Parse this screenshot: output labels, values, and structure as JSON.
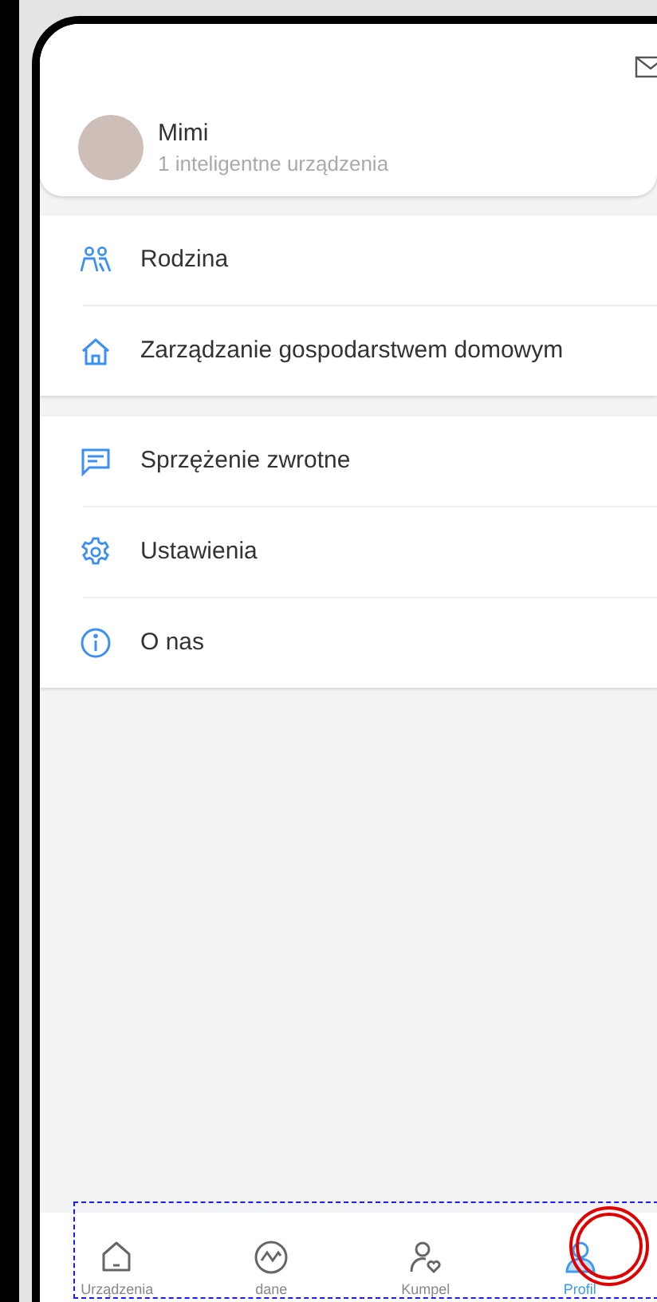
{
  "profile": {
    "name": "Mimi",
    "subtitle": "1 inteligentne urządzenia"
  },
  "menu_groups": [
    {
      "items": [
        {
          "kind": "family",
          "label": "Rodzina"
        },
        {
          "kind": "home",
          "label": "Zarządzanie gospodarstwem domowym"
        }
      ]
    },
    {
      "items": [
        {
          "kind": "feedback",
          "label": "Sprzężenie zwrotne"
        },
        {
          "kind": "settings",
          "label": "Ustawienia"
        },
        {
          "kind": "info",
          "label": "O nas"
        }
      ]
    }
  ],
  "bottom_nav": [
    {
      "kind": "devices",
      "label": "Urządzenia",
      "selected": false
    },
    {
      "kind": "data",
      "label": "dane",
      "selected": false
    },
    {
      "kind": "buddy",
      "label": "Kumpel",
      "selected": false
    },
    {
      "kind": "profile",
      "label": "Profil",
      "selected": true
    }
  ]
}
